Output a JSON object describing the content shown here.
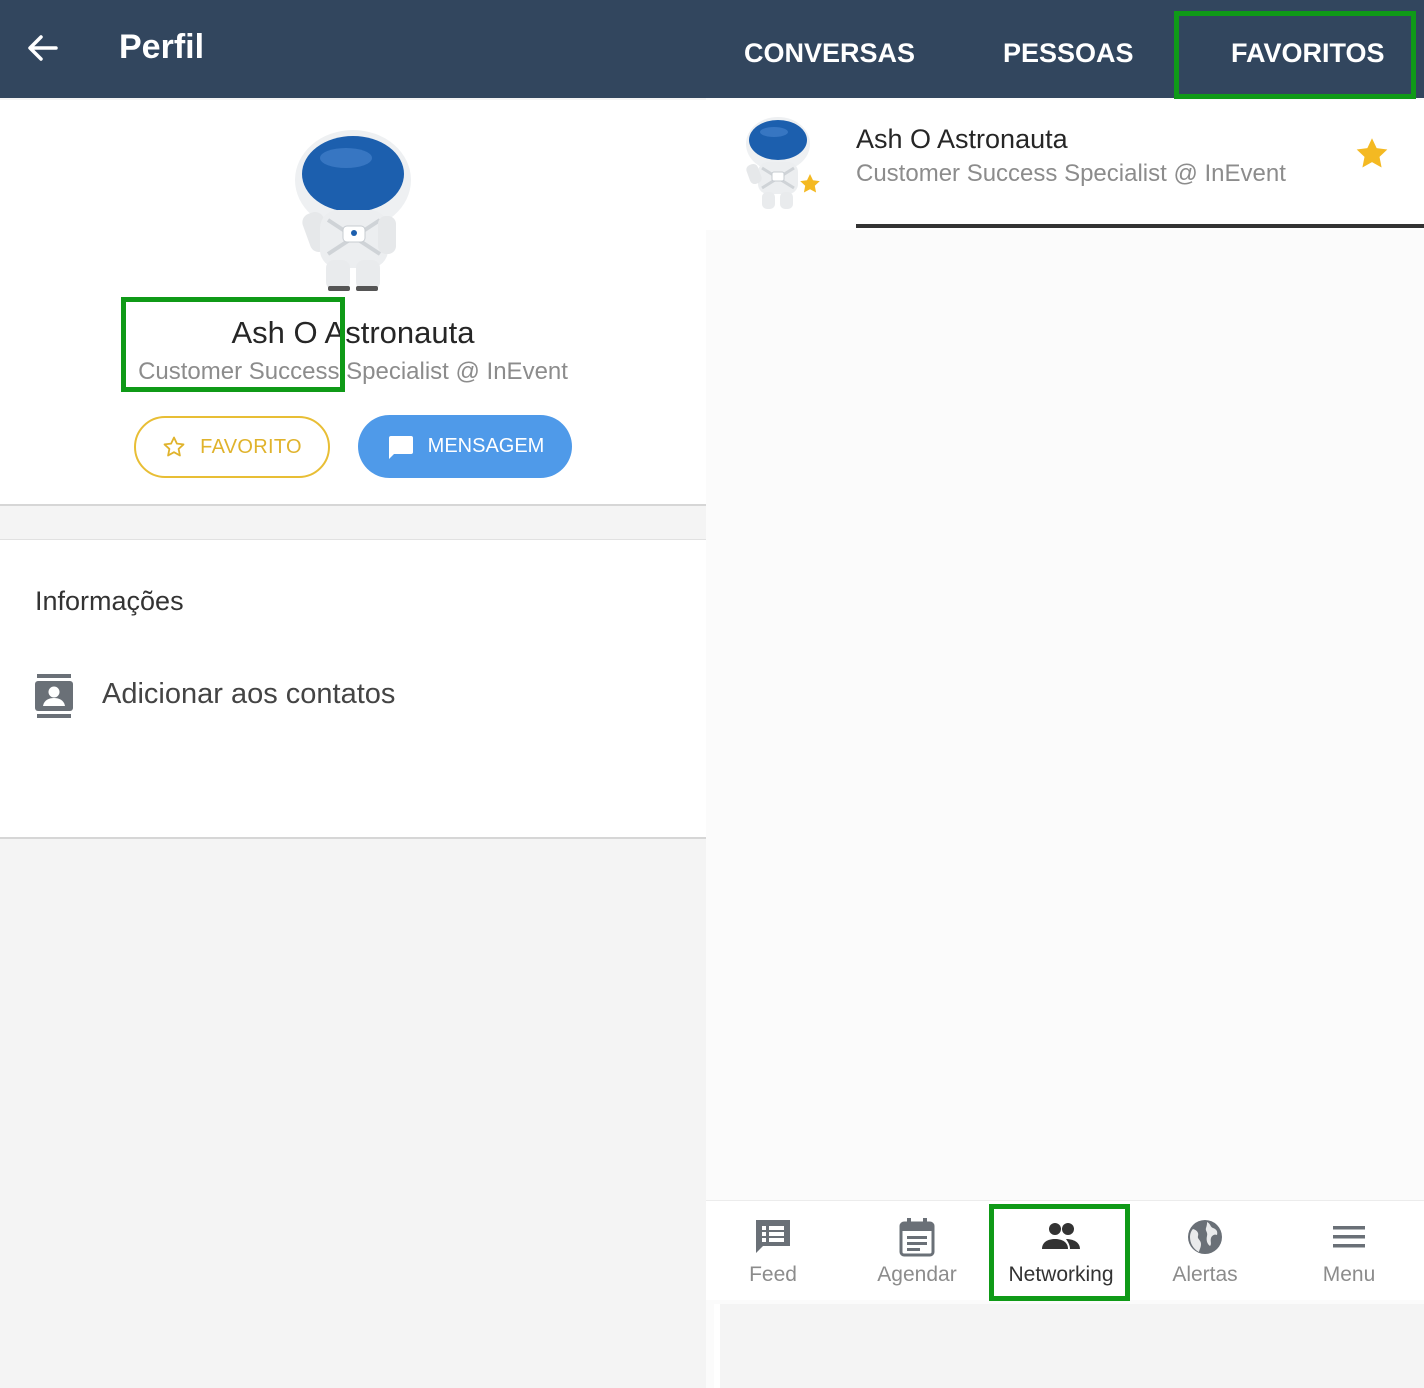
{
  "left": {
    "header": {
      "title": "Perfil"
    },
    "profile": {
      "name": "Ash O Astronauta",
      "role": "Customer Success Specialist @ InEvent",
      "favorite_label": "FAVORITO",
      "message_label": "MENSAGEM"
    },
    "info": {
      "title": "Informações",
      "add_contact_label": "Adicionar aos contatos"
    }
  },
  "right": {
    "tabs": [
      {
        "label": "CONVERSAS"
      },
      {
        "label": "PESSOAS"
      },
      {
        "label": "FAVORITOS",
        "selected": true
      }
    ],
    "favorites": [
      {
        "name": "Ash O Astronauta",
        "role": "Customer Success Specialist @ InEvent",
        "starred": true
      }
    ],
    "bottom_nav": [
      {
        "label": "Feed",
        "icon": "feed-icon"
      },
      {
        "label": "Agendar",
        "icon": "calendar-icon"
      },
      {
        "label": "Networking",
        "icon": "people-icon",
        "active": true
      },
      {
        "label": "Alertas",
        "icon": "globe-icon"
      },
      {
        "label": "Menu",
        "icon": "menu-icon"
      }
    ]
  },
  "colors": {
    "header": "#32465e",
    "highlight": "#0f9a17",
    "favorite": "#e8be35",
    "message_button": "#4f9ae9",
    "star": "#f4b922"
  }
}
